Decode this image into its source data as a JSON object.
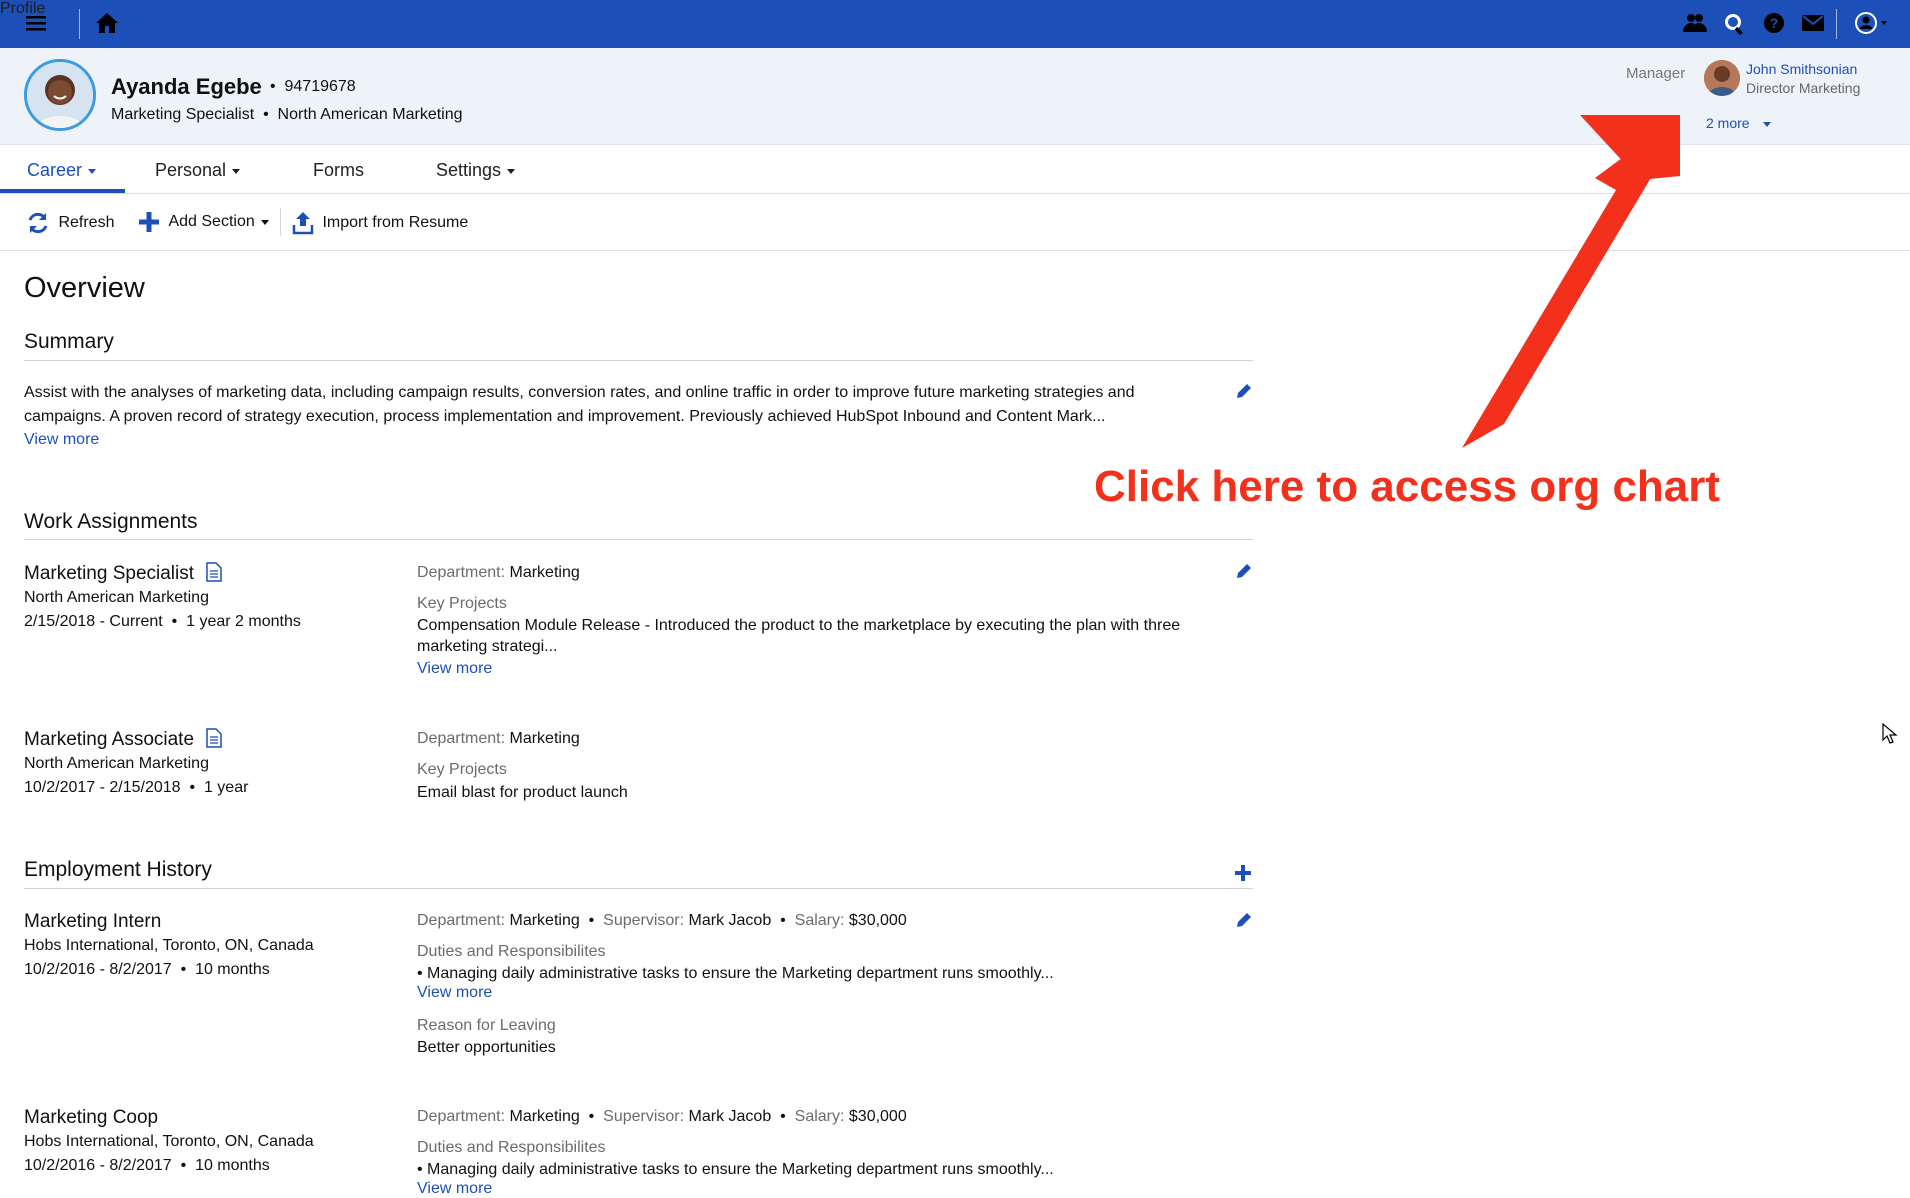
{
  "topbar": {
    "title": "Profile",
    "icons": [
      "menu-icon",
      "home-icon",
      "org-chart-icon",
      "search-icon",
      "help-icon",
      "mail-icon",
      "user-account-icon"
    ]
  },
  "employee": {
    "name": "Ayanda Egebe",
    "id_text": "•  94719678",
    "subtitle": "Marketing Specialist  •  North American Marketing"
  },
  "manager": {
    "label": "Manager",
    "name": "John Smithsonian",
    "title": "Director Marketing",
    "more_label": "2 more"
  },
  "tabs": [
    {
      "label": "Career",
      "active": true
    },
    {
      "label": "Personal"
    },
    {
      "label": "Forms"
    },
    {
      "label": "Settings"
    }
  ],
  "toolbar": {
    "refresh": "Refresh",
    "add_section": "Add Section",
    "import": "Import from Resume"
  },
  "overview": {
    "title": "Overview",
    "summary": {
      "heading": "Summary",
      "line1": "Assist with the analyses of marketing data, including campaign results, conversion rates, and online traffic in order to improve future marketing strategies and",
      "line2": "campaigns. A proven record of strategy execution, process implementation and improvement. Previously achieved HubSpot Inbound and Content Mark...",
      "view_more": "View more"
    },
    "work_assignments": {
      "heading": "Work Assignments",
      "items": [
        {
          "title": "Marketing Specialist",
          "org": "North American Marketing",
          "dates": "2/15/2018 - Current  •  1 year 2 months",
          "dept_label": "Department:",
          "dept": "Marketing",
          "projects_label": "Key Projects",
          "projects_line1": "Compensation Module Release - Introduced the product to the marketplace by executing the plan with three",
          "projects_line2": "marketing strategi...",
          "view_more": "View more"
        },
        {
          "title": "Marketing Associate",
          "org": "North American Marketing",
          "dates": "10/2/2017 - 2/15/2018  •  1 year",
          "dept_label": "Department:",
          "dept": "Marketing",
          "projects_label": "Key Projects",
          "projects_line1": "Email blast for product launch"
        }
      ]
    },
    "employment_history": {
      "heading": "Employment History",
      "items": [
        {
          "title": "Marketing Intern",
          "org": "Hobs International, Toronto, ON, Canada",
          "dates": "10/2/2016 - 8/2/2017  •  10 months",
          "dept_label": "Department:",
          "dept": "Marketing",
          "sup_label": "Supervisor:",
          "sup": "Mark Jacob",
          "sal_label": "Salary:",
          "sal": "$30,000",
          "duties_label": "Duties and Responsibilites",
          "duties": "• Managing daily administrative tasks to ensure the Marketing department runs smoothly...",
          "view_more": "View more",
          "leaving_label": "Reason for Leaving",
          "leaving": "Better opportunities"
        },
        {
          "title": "Marketing Coop",
          "org": "Hobs International, Toronto, ON, Canada",
          "dates": "10/2/2016 - 8/2/2017  •  10 months",
          "dept_label": "Department:",
          "dept": "Marketing",
          "sup_label": "Supervisor:",
          "sup": "Mark Jacob",
          "sal_label": "Salary:",
          "sal": "$30,000",
          "duties_label": "Duties and Responsibilites",
          "duties": "• Managing daily administrative tasks to ensure the Marketing department runs smoothly...",
          "view_more": "View more"
        }
      ]
    }
  },
  "annotation": {
    "text": "Click here to access org chart",
    "color": "#f2301c"
  },
  "colors": {
    "brand": "#1d4fb9",
    "header_bg": "#eef2f9"
  }
}
